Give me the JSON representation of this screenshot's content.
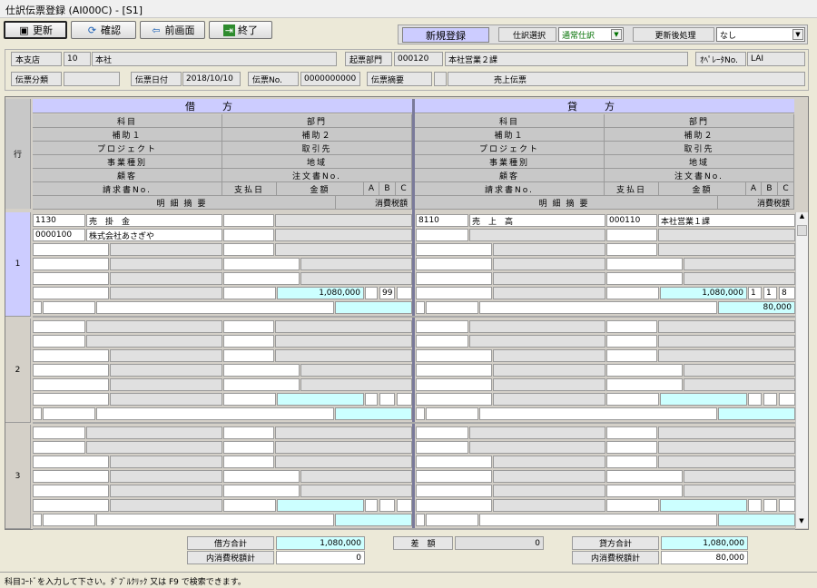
{
  "window": {
    "title": "仕訳伝票登録 (AI000C) - [S1]"
  },
  "toolbar": {
    "update": "更新",
    "confirm": "確認",
    "prev": "前画面",
    "exit": "終了"
  },
  "mode": {
    "new_entry": "新規登録",
    "journal_select_label": "仕訳選択",
    "journal_select_value": "通常仕訳",
    "after_update_label": "更新後処理",
    "after_update_value": "なし"
  },
  "header": {
    "branch_label": "本支店",
    "branch_code": "10",
    "branch_name": "本社",
    "dept_label": "起票部門",
    "dept_code": "000120",
    "dept_name": "本社営業２課",
    "operator_label": "ｵﾍﾟﾚｰﾀNo.",
    "operator_value": "LAI",
    "slip_type_label": "伝票分類",
    "slip_type_value": "",
    "slip_date_label": "伝票日付",
    "slip_date_value": "2018/10/10",
    "slip_no_label": "伝票No.",
    "slip_no_value": "0000000000",
    "slip_summary_label": "伝票摘要",
    "slip_summary_value": "売上伝票"
  },
  "grid_header": {
    "row": "行",
    "debit": "借方",
    "credit": "貸方",
    "account": "科目",
    "department": "部門",
    "sub1": "補助１",
    "sub2": "補助２",
    "project": "プロジェクト",
    "partner": "取引先",
    "business": "事業種別",
    "region": "地域",
    "customer": "顧客",
    "order_no": "注文書No.",
    "invoice_no": "請求書No.",
    "pay_date": "支払日",
    "amount": "金額",
    "a": "A",
    "b": "B",
    "c": "C",
    "detail": "明細摘要",
    "tax": "消費税額"
  },
  "rows": [
    {
      "no": "1",
      "debit": {
        "account_code": "1130",
        "account_name": "売　掛　金",
        "sub1_code": "0000100",
        "sub1_name": "株式会社あさぎや",
        "amount": "1,080,000",
        "abc": "99",
        "tax": ""
      },
      "credit": {
        "account_code": "8110",
        "account_name": "売　上　高",
        "dept_code": "000110",
        "dept_name": "本社営業１課",
        "amount": "1,080,000",
        "a": "1",
        "b": "1",
        "c": "8",
        "tax": "80,000"
      }
    },
    {
      "no": "2"
    },
    {
      "no": "3"
    }
  ],
  "footer": {
    "debit_total_label": "借方合計",
    "debit_total": "1,080,000",
    "debit_tax_label": "内消費税額計",
    "debit_tax": "0",
    "diff_label": "差　額",
    "diff": "0",
    "credit_total_label": "貸方合計",
    "credit_total": "1,080,000",
    "credit_tax_label": "内消費税額計",
    "credit_tax": "80,000"
  },
  "status": "科目ｺｰﾄﾞを入力して下さい。ﾀﾞﾌﾞﾙｸﾘｯｸ 又は F9 で検索できます。"
}
